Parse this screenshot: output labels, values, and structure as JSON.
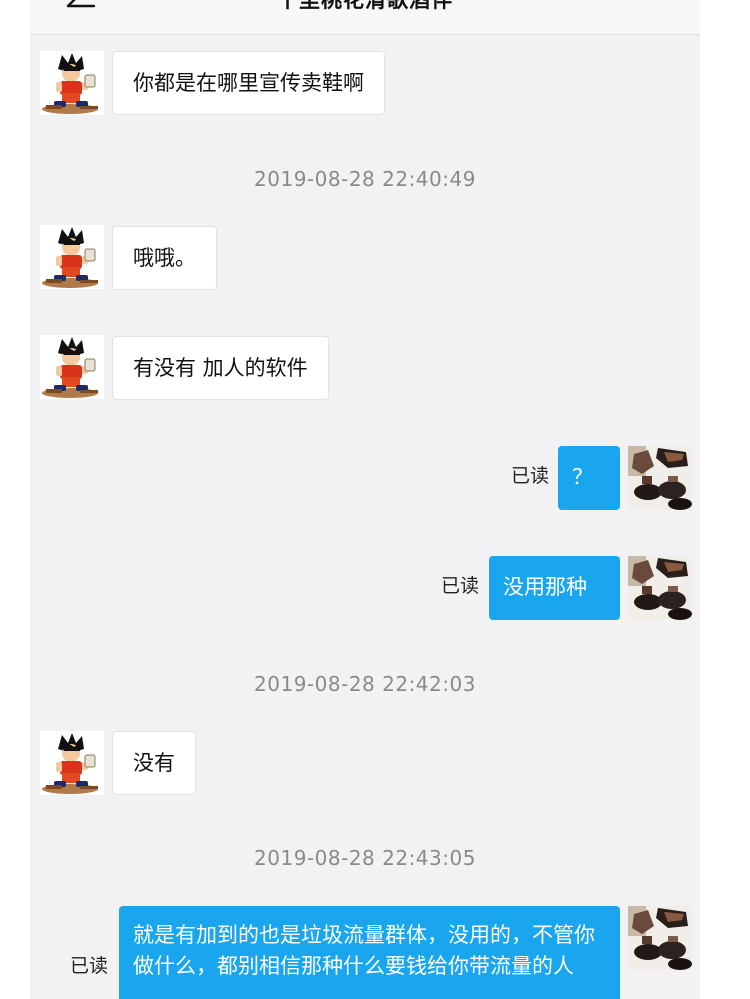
{
  "header": {
    "title": "十里桃花清歌酒伴"
  },
  "messages": [
    {
      "text": "你都是在哪里宣传卖鞋啊"
    },
    {
      "timestamp": "2019-08-28 22:40:49"
    },
    {
      "text": "哦哦。"
    },
    {
      "text": "有没有 加人的软件"
    },
    {
      "text": "？",
      "status": "已读"
    },
    {
      "text": "没用那种",
      "status": "已读"
    },
    {
      "timestamp": "2019-08-28 22:42:03"
    },
    {
      "text": "没有"
    },
    {
      "timestamp": "2019-08-28 22:43:05"
    },
    {
      "text": "就是有加到的也是垃圾流量群体，没用的，不管你做什么，都别相信那种什么要钱给你带流量的人",
      "status": "已读"
    }
  ],
  "colors": {
    "outgoing_bubble": "#1aa6ee",
    "incoming_bubble": "#ffffff",
    "background": "#f2f2f4",
    "timestamp_text": "#8a8a8e"
  },
  "icons": {
    "back": "arrow-left-icon",
    "more": "more-dots-icon"
  }
}
